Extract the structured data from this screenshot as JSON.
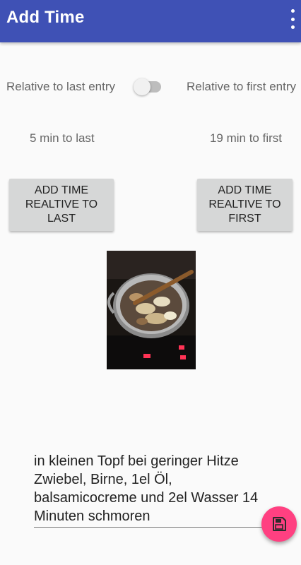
{
  "appbar": {
    "title": "Add Time",
    "menu_icon": "more-vert-icon"
  },
  "mode": {
    "left_label": "Relative to last entry",
    "right_label": "Relative to first entry",
    "switch_on": false
  },
  "diffs": {
    "to_last": "5 min to last",
    "to_first": "19 min to first"
  },
  "buttons": {
    "add_relative_last": "ADD TIME REALTIVE TO LAST",
    "add_relative_first": "ADD TIME REALTIVE TO FIRST"
  },
  "photo": {
    "icon": "cooking-pot-photo"
  },
  "note": {
    "text": "in kleinen Topf bei geringer Hitze Zwiebel, Birne, 1el Öl, balsamicocreme und 2el Wasser 14 Minuten schmoren"
  },
  "fab": {
    "icon": "save-icon",
    "color": "#ff4081"
  },
  "colors": {
    "primary": "#3f51b5",
    "accent": "#ff4081"
  }
}
